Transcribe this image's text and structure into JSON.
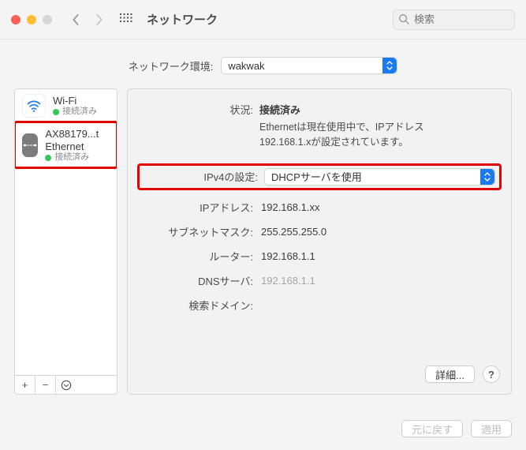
{
  "window": {
    "title": "ネットワーク",
    "searchPlaceholder": "検索"
  },
  "location": {
    "label": "ネットワーク環境:",
    "value": "wakwak"
  },
  "sidebar": {
    "items": [
      {
        "name": "Wi-Fi",
        "status": "接続済み"
      },
      {
        "name": "AX88179...t Ethernet",
        "status": "接続済み"
      }
    ],
    "footer": {
      "add": "+",
      "remove": "−",
      "more": "⊙"
    }
  },
  "status": {
    "label": "状況:",
    "value": "接続済み",
    "desc1": "Ethernetは現在使用中で、IPアドレス",
    "desc2": "192.168.1.xが設定されています。"
  },
  "ipv4": {
    "label": "IPv4の設定:",
    "value": "DHCPサーバを使用"
  },
  "rows": [
    {
      "label": "IPアドレス:",
      "value": "192.168.1.xx",
      "dim": false
    },
    {
      "label": "サブネットマスク:",
      "value": "255.255.255.0",
      "dim": false
    },
    {
      "label": "ルーター:",
      "value": "192.168.1.1",
      "dim": false
    },
    {
      "label": "DNSサーバ:",
      "value": "192.168.1.1",
      "dim": true
    },
    {
      "label": "検索ドメイン:",
      "value": "",
      "dim": false
    }
  ],
  "buttons": {
    "advanced": "詳細...",
    "help": "?",
    "revert": "元に戻す",
    "apply": "適用"
  }
}
